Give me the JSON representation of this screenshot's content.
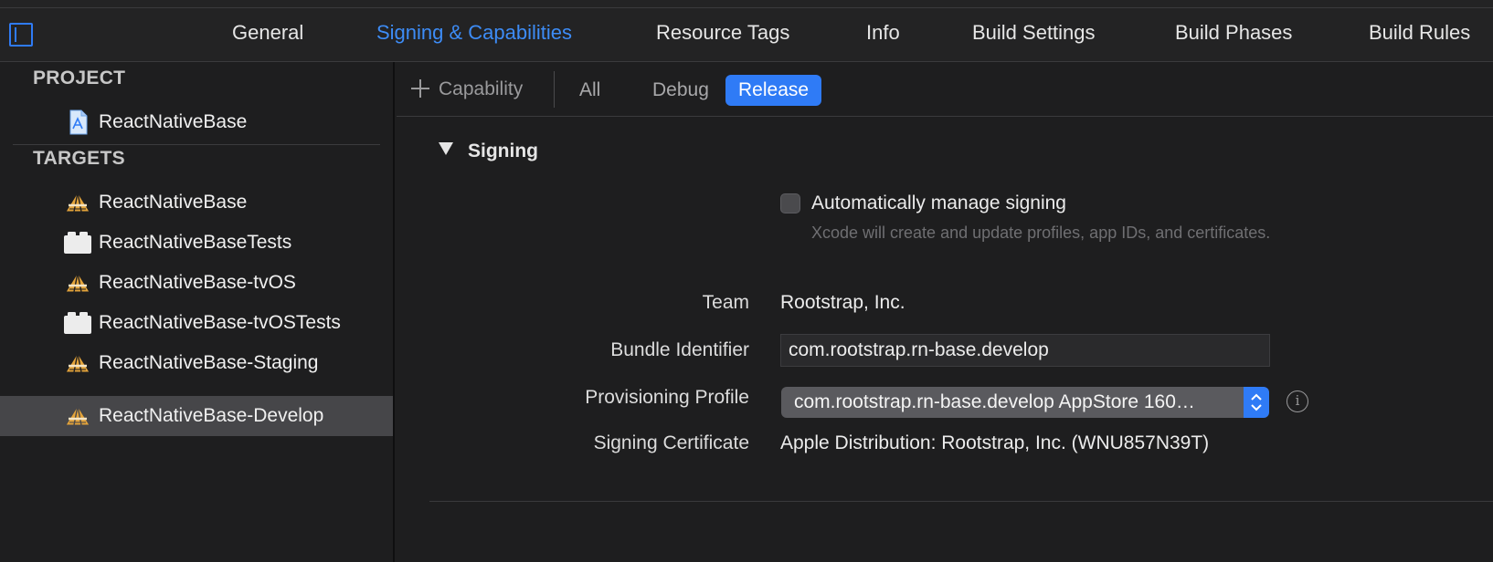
{
  "tabs": [
    {
      "label": "General"
    },
    {
      "label": "Signing & Capabilities",
      "active": true
    },
    {
      "label": "Resource Tags"
    },
    {
      "label": "Info"
    },
    {
      "label": "Build Settings"
    },
    {
      "label": "Build Phases"
    },
    {
      "label": "Build Rules"
    }
  ],
  "sidebar": {
    "project_header": "PROJECT",
    "project_item": {
      "label": "ReactNativeBase",
      "icon": "xcode-project-icon"
    },
    "targets_header": "TARGETS",
    "targets": [
      {
        "label": "ReactNativeBase",
        "icon": "app-target-icon"
      },
      {
        "label": "ReactNativeBaseTests",
        "icon": "test-bundle-icon"
      },
      {
        "label": "ReactNativeBase-tvOS",
        "icon": "app-target-icon"
      },
      {
        "label": "ReactNativeBase-tvOSTests",
        "icon": "test-bundle-icon"
      },
      {
        "label": "ReactNativeBase-Staging",
        "icon": "app-target-icon"
      },
      {
        "label": "ReactNativeBase-Develop",
        "icon": "app-target-icon",
        "selected": true
      }
    ]
  },
  "toolbar": {
    "capability_label": "Capability",
    "filters": [
      {
        "label": "All"
      },
      {
        "label": "Debug"
      },
      {
        "label": "Release",
        "active": true
      }
    ]
  },
  "signing": {
    "section_title": "Signing",
    "auto_manage_label": "Automatically manage signing",
    "auto_manage_help": "Xcode will create and update profiles, app IDs, and certificates.",
    "auto_manage_checked": false,
    "team_label": "Team",
    "team_value": "Rootstrap, Inc.",
    "bundle_id_label": "Bundle Identifier",
    "bundle_id_value": "com.rootstrap.rn-base.develop",
    "profile_label": "Provisioning Profile",
    "profile_value": "com.rootstrap.rn-base.develop AppStore 160…",
    "certificate_label": "Signing Certificate",
    "certificate_value": "Apple Distribution: Rootstrap, Inc. (WNU857N39T)"
  },
  "colors": {
    "accent": "#2f7bf6",
    "active_tab_text": "#3d8cf6",
    "background": "#1e1e1f",
    "selected_row": "#464649"
  }
}
